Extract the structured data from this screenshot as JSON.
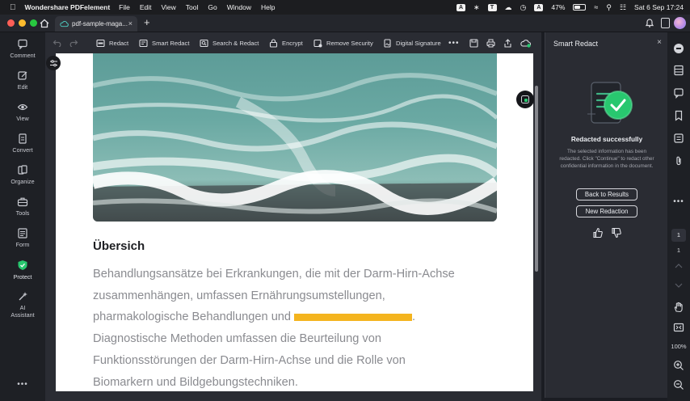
{
  "menubar": {
    "app_name": "Wondershare PDFelement",
    "items": [
      "File",
      "Edit",
      "View",
      "Tool",
      "Go",
      "Window",
      "Help"
    ],
    "battery": "47%",
    "datetime": "Sat 6 Sep  17:24"
  },
  "tabs": {
    "document_tab": "pdf-sample-maga...",
    "new_tab": "+"
  },
  "sidebar": {
    "items": [
      {
        "label": "Comment",
        "icon": "comment-icon"
      },
      {
        "label": "Edit",
        "icon": "edit-icon"
      },
      {
        "label": "View",
        "icon": "eye-icon"
      },
      {
        "label": "Convert",
        "icon": "convert-icon"
      },
      {
        "label": "Organize",
        "icon": "organize-icon"
      },
      {
        "label": "Tools",
        "icon": "toolbox-icon"
      },
      {
        "label": "Form",
        "icon": "form-icon"
      },
      {
        "label": "Protect",
        "icon": "shield-icon"
      },
      {
        "label": "AI Assistant",
        "icon": "sparkle-icon"
      }
    ],
    "more": "•••"
  },
  "toolbar": {
    "redact": "Redact",
    "smart_redact": "Smart Redact",
    "search_redact": "Search & Redact",
    "encrypt": "Encrypt",
    "remove_security": "Remove Security",
    "digital_signature": "Digital Signature",
    "more": "•••"
  },
  "document": {
    "heading": "Übersich",
    "lines": [
      "Behandlungsansätze bei Erkrankungen, die mit der Darm-Hirn-Achse",
      "zusammenhängen, umfassen Ernährungsumstellungen,",
      "pharmakologische Behandlungen und",
      ".",
      "Diagnostische Methoden umfassen die Beurteilung von",
      "Funktionsstörungen der Darm-Hirn-Achse und die Rolle von",
      "Biomarkern und Bildgebungstechniken."
    ],
    "redaction_color": "#f4b41e"
  },
  "panel": {
    "title": "Smart Redact",
    "status_title": "Redacted successfully",
    "status_desc": "The selected information has been redacted. Click \"Continue\" to redact other confidential information in the document.",
    "back_button": "Back to Results",
    "new_button": "New Redaction"
  },
  "rail": {
    "more": "•••",
    "current_page": "1",
    "total_pages": "1",
    "zoom": "100%"
  },
  "colors": {
    "accent_green": "#28c76f",
    "redaction": "#f4b41e"
  }
}
